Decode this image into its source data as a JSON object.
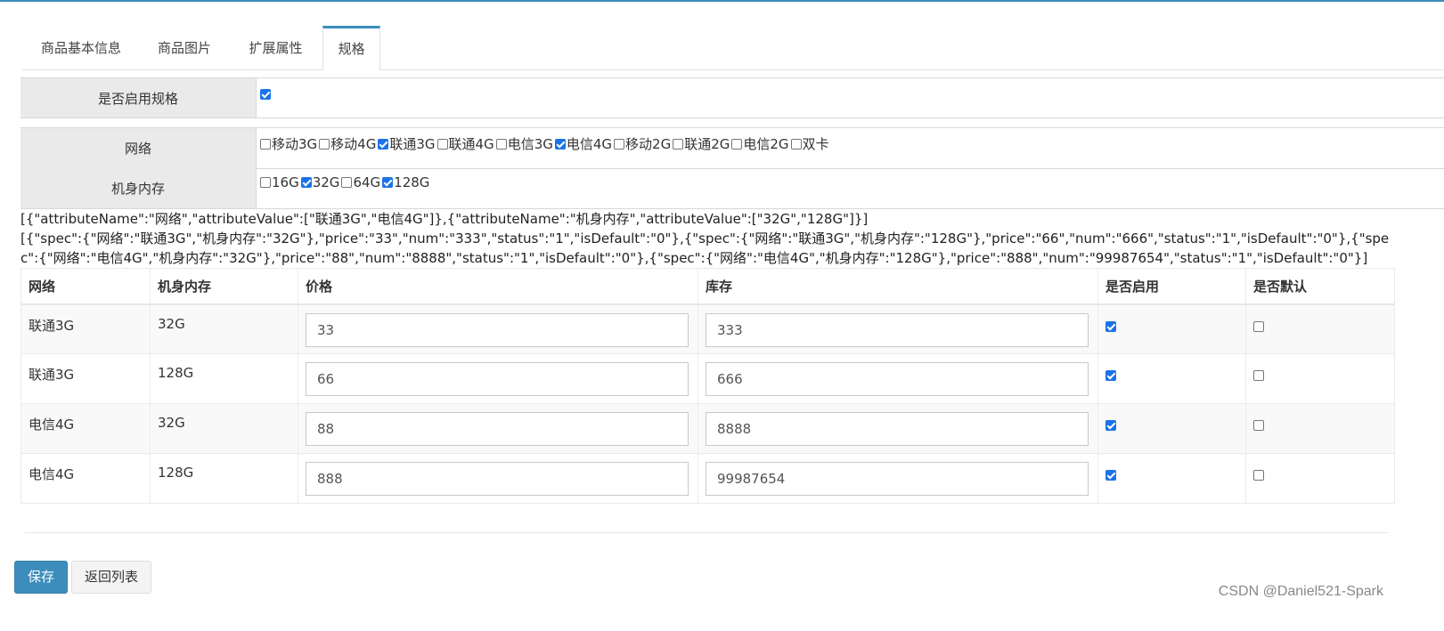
{
  "tabs": [
    {
      "label": "商品基本信息",
      "active": false
    },
    {
      "label": "商品图片",
      "active": false
    },
    {
      "label": "扩展属性",
      "active": false
    },
    {
      "label": "规格",
      "active": true
    }
  ],
  "enable_spec": {
    "label": "是否启用规格",
    "checked": true
  },
  "network": {
    "label": "网络",
    "options": [
      {
        "label": "移动3G",
        "checked": false
      },
      {
        "label": "移动4G",
        "checked": false
      },
      {
        "label": "联通3G",
        "checked": true
      },
      {
        "label": "联通4G",
        "checked": false
      },
      {
        "label": "电信3G",
        "checked": false
      },
      {
        "label": "电信4G",
        "checked": true
      },
      {
        "label": "移动2G",
        "checked": false
      },
      {
        "label": "联通2G",
        "checked": false
      },
      {
        "label": "电信2G",
        "checked": false
      },
      {
        "label": "双卡",
        "checked": false
      }
    ]
  },
  "memory": {
    "label": "机身内存",
    "options": [
      {
        "label": "16G",
        "checked": false
      },
      {
        "label": "32G",
        "checked": true
      },
      {
        "label": "64G",
        "checked": false
      },
      {
        "label": "128G",
        "checked": true
      }
    ]
  },
  "json_output": {
    "attributes": "[{\"attributeName\":\"网络\",\"attributeValue\":[\"联通3G\",\"电信4G\"]},{\"attributeName\":\"机身内存\",\"attributeValue\":[\"32G\",\"128G\"]}]",
    "items": "[{\"spec\":{\"网络\":\"联通3G\",\"机身内存\":\"32G\"},\"price\":\"33\",\"num\":\"333\",\"status\":\"1\",\"isDefault\":\"0\"},{\"spec\":{\"网络\":\"联通3G\",\"机身内存\":\"128G\"},\"price\":\"66\",\"num\":\"666\",\"status\":\"1\",\"isDefault\":\"0\"},{\"spec\":{\"网络\":\"电信4G\",\"机身内存\":\"32G\"},\"price\":\"88\",\"num\":\"8888\",\"status\":\"1\",\"isDefault\":\"0\"},{\"spec\":{\"网络\":\"电信4G\",\"机身内存\":\"128G\"},\"price\":\"888\",\"num\":\"99987654\",\"status\":\"1\",\"isDefault\":\"0\"}]"
  },
  "table": {
    "headers": [
      "网络",
      "机身内存",
      "价格",
      "库存",
      "是否启用",
      "是否默认"
    ],
    "rows": [
      {
        "network": "联通3G",
        "memory": "32G",
        "price": "33",
        "stock": "333",
        "enabled": true,
        "is_default": false
      },
      {
        "network": "联通3G",
        "memory": "128G",
        "price": "66",
        "stock": "666",
        "enabled": true,
        "is_default": false
      },
      {
        "network": "电信4G",
        "memory": "32G",
        "price": "88",
        "stock": "8888",
        "enabled": true,
        "is_default": false
      },
      {
        "network": "电信4G",
        "memory": "128G",
        "price": "888",
        "stock": "99987654",
        "enabled": true,
        "is_default": false
      }
    ]
  },
  "buttons": {
    "save": "保存",
    "back": "返回列表"
  },
  "watermark": "CSDN @Daniel521-Spark",
  "colors": {
    "primary": "#3c8dbc",
    "checkbox": "#1a73e8",
    "label_bg": "#eaeaea"
  }
}
